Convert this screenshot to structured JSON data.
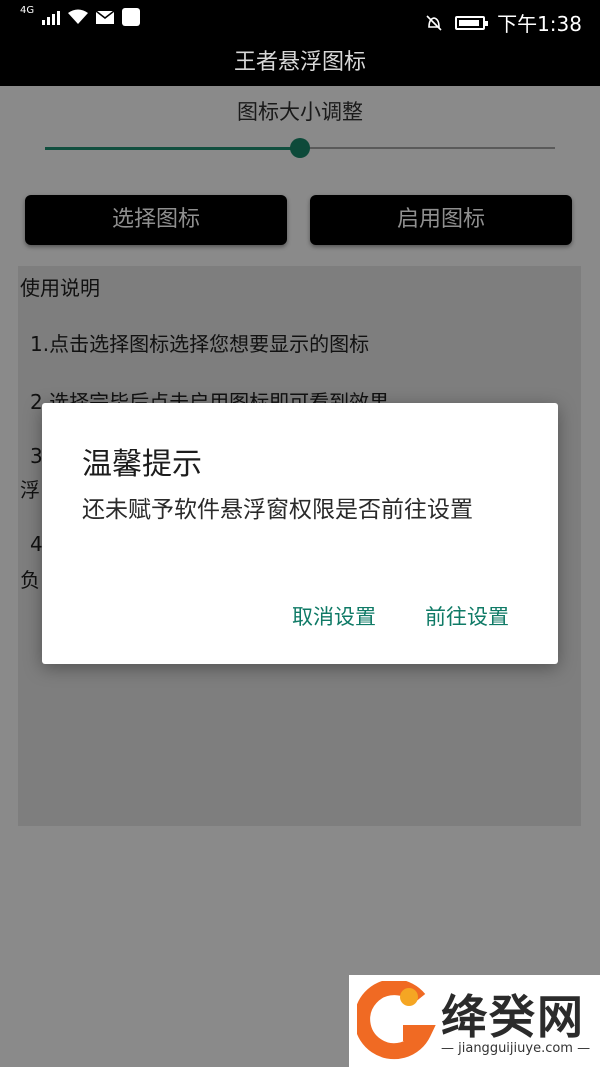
{
  "status": {
    "network": "4G",
    "time": "下午1:38",
    "icons": [
      "signal-icon",
      "wifi-icon",
      "mail-icon",
      "app-store-icon",
      "bell-off-icon",
      "battery-icon"
    ]
  },
  "appbar": {
    "title": "王者悬浮图标"
  },
  "settings": {
    "size_label": "图标大小调整",
    "slider_value_percent": 50
  },
  "buttons": {
    "select": "选择图标",
    "enable": "启用图标"
  },
  "instructions": {
    "title": "使用说明",
    "line1": "1.点击选择图标选择您想要显示的图标",
    "line2": "2.选择完毕后点击启用图标即可看到效果",
    "line3_left": "3",
    "line3_wrap": "浮",
    "line4_left": "4",
    "line4_wrap": "负"
  },
  "dialog": {
    "title": "温馨提示",
    "message": "还未赋予软件悬浮窗权限是否前往设置",
    "cancel": "取消设置",
    "confirm": "前往设置"
  },
  "watermark": {
    "brand": "绛癸网",
    "url": "— jiangguijiuye.com —"
  },
  "colors": {
    "accent": "#0f7a66",
    "overlay_bg": "#8a8a8a",
    "bar": "#000000"
  }
}
